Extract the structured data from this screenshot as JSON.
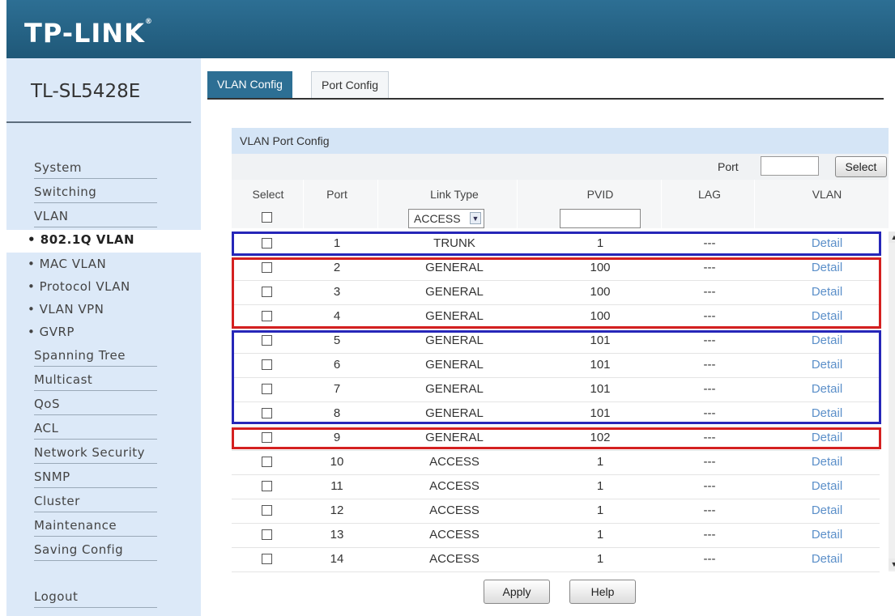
{
  "brand": {
    "logo": "TP-LINK",
    "logo_mark": "®"
  },
  "sidebar": {
    "model": "TL-SL5428E",
    "items": [
      "System",
      "Switching",
      "VLAN"
    ],
    "active_sub": "• 802.1Q VLAN",
    "sub_items": [
      "• MAC VLAN",
      "• Protocol VLAN",
      "• VLAN VPN",
      "• GVRP"
    ],
    "items2": [
      "Spanning Tree",
      "Multicast",
      "QoS",
      "ACL",
      "Network Security",
      "SNMP",
      "Cluster",
      "Maintenance",
      "Saving Config"
    ],
    "logout": "Logout"
  },
  "tabs": {
    "active": "VLAN Config",
    "inactive": "Port Config"
  },
  "panel": {
    "title": "VLAN Port Config",
    "port_label": "Port",
    "select_button": "Select",
    "columns": {
      "select": "Select",
      "port": "Port",
      "link_type": "Link Type",
      "pvid": "PVID",
      "lag": "LAG",
      "vlan": "VLAN"
    },
    "link_type_selected": "ACCESS",
    "rows": [
      {
        "port": "1",
        "link_type": "TRUNK",
        "pvid": "1",
        "lag": "---",
        "vlan": "Detail"
      },
      {
        "port": "2",
        "link_type": "GENERAL",
        "pvid": "100",
        "lag": "---",
        "vlan": "Detail"
      },
      {
        "port": "3",
        "link_type": "GENERAL",
        "pvid": "100",
        "lag": "---",
        "vlan": "Detail"
      },
      {
        "port": "4",
        "link_type": "GENERAL",
        "pvid": "100",
        "lag": "---",
        "vlan": "Detail"
      },
      {
        "port": "5",
        "link_type": "GENERAL",
        "pvid": "101",
        "lag": "---",
        "vlan": "Detail"
      },
      {
        "port": "6",
        "link_type": "GENERAL",
        "pvid": "101",
        "lag": "---",
        "vlan": "Detail"
      },
      {
        "port": "7",
        "link_type": "GENERAL",
        "pvid": "101",
        "lag": "---",
        "vlan": "Detail"
      },
      {
        "port": "8",
        "link_type": "GENERAL",
        "pvid": "101",
        "lag": "---",
        "vlan": "Detail"
      },
      {
        "port": "9",
        "link_type": "GENERAL",
        "pvid": "102",
        "lag": "---",
        "vlan": "Detail"
      },
      {
        "port": "10",
        "link_type": "ACCESS",
        "pvid": "1",
        "lag": "---",
        "vlan": "Detail"
      },
      {
        "port": "11",
        "link_type": "ACCESS",
        "pvid": "1",
        "lag": "---",
        "vlan": "Detail"
      },
      {
        "port": "12",
        "link_type": "ACCESS",
        "pvid": "1",
        "lag": "---",
        "vlan": "Detail"
      },
      {
        "port": "13",
        "link_type": "ACCESS",
        "pvid": "1",
        "lag": "---",
        "vlan": "Detail"
      },
      {
        "port": "14",
        "link_type": "ACCESS",
        "pvid": "1",
        "lag": "---",
        "vlan": "Detail"
      }
    ]
  },
  "buttons": {
    "apply": "Apply",
    "help": "Help"
  },
  "colors": {
    "header": "#2d6f94",
    "sidebar": "#dce9f8",
    "highlight_blue": "#2626b8",
    "highlight_red": "#d42020",
    "link": "#5b8fc9"
  },
  "icons": {
    "dropdown": "chevron-down-icon",
    "scroll_up": "arrow-up-icon",
    "scroll_down": "arrow-down-icon"
  }
}
